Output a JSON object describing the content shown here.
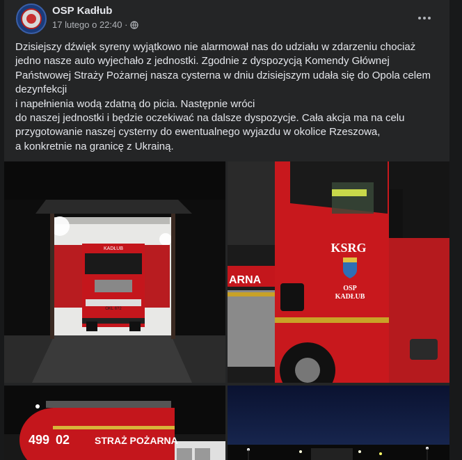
{
  "post": {
    "page_name": "OSP Kadłub",
    "timestamp": "17 lutego o 22:40 ·",
    "privacy_icon": "globe-icon",
    "more_icon": "more-options-icon",
    "paragraph_1": "Dzisiejszy dźwięk syreny wyjątkowo nie alarmował nas do udziału w zdarzeniu chociaż\njedno nasze auto wyjechało z jednostki. Zgodnie z dyspozycją Komendy Głównej\nPaństwowej Straży Pożarnej nasza cysterna w dniu dzisiejszym udała się do Opola celem\ndezynfekcji\ni napełnienia wodą zdatną do picia. Następnie wróci\ndo naszej jednostki i będzie oczekiwać na dalsze dyspozycje. Cała akcja ma na celu\nprzygotowanie naszej cysterny do ewentualnego wyjazdu w okolice Rzeszowa,\na konkretnie na granicę z Ukrainą."
  },
  "photos": {
    "photo_1": {
      "truck_sign": "KADŁUB",
      "plate": "OKL 6?2"
    },
    "photo_2": {
      "door_title": "KSRG",
      "door_osp": "OSP",
      "door_name": "KADŁUB",
      "side_text": "ARNA"
    },
    "photo_3": {
      "number": "499",
      "number_suffix": "02",
      "side_text": "STRAŻ POŻARNA"
    }
  },
  "colors": {
    "background": "#18191a",
    "card": "#242526",
    "text": "#e4e6eb",
    "secondary": "#b0b3b8",
    "truck_red": "#c4161c"
  }
}
